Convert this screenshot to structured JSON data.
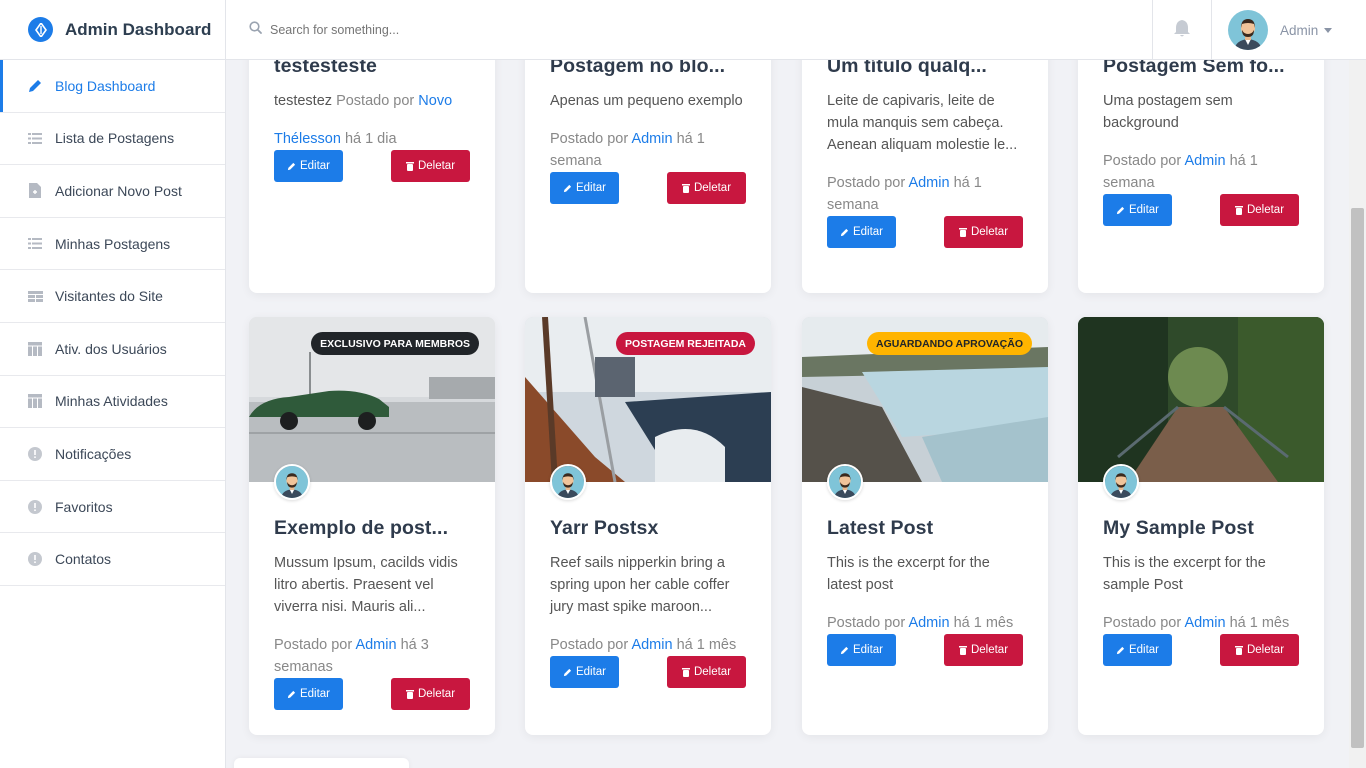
{
  "app": {
    "title": "Admin Dashboard"
  },
  "sidebar": {
    "items": [
      {
        "label": "Blog Dashboard",
        "icon": "pencil-icon",
        "active": true
      },
      {
        "label": "Lista de Postagens",
        "icon": "list-icon"
      },
      {
        "label": "Adicionar Novo Post",
        "icon": "file-add-icon"
      },
      {
        "label": "Minhas Postagens",
        "icon": "list-icon"
      },
      {
        "label": "Visitantes do Site",
        "icon": "table-icon"
      },
      {
        "label": "Ativ. dos Usuários",
        "icon": "calendar-icon"
      },
      {
        "label": "Minhas Atividades",
        "icon": "calendar-icon"
      },
      {
        "label": "Notificações",
        "icon": "alert-circle-icon"
      },
      {
        "label": "Favoritos",
        "icon": "alert-circle-icon"
      },
      {
        "label": "Contatos",
        "icon": "alert-circle-icon"
      }
    ]
  },
  "topbar": {
    "search_placeholder": "Search for something...",
    "user_name": "Admin"
  },
  "buttons": {
    "edit": "Editar",
    "delete": "Deletar"
  },
  "posts_top": [
    {
      "title": "testesteste",
      "excerpt": "testestez",
      "meta_prefix": "Postado por",
      "author": "Novo Thélesson",
      "time": "há 1 dia"
    },
    {
      "title": "Postagem no blo...",
      "excerpt": "Apenas um pequeno exemplo",
      "meta_prefix": "Postado por",
      "author": "Admin",
      "time": "há 1 semana"
    },
    {
      "title": "Um título qualq...",
      "excerpt": "Leite de capivaris, leite de mula manquis sem cabeça. Aenean aliquam molestie le...",
      "meta_prefix": "Postado por",
      "author": "Admin",
      "time": "há 1 semana"
    },
    {
      "title": "Postagem Sem fo...",
      "excerpt": "Uma postagem sem background",
      "meta_prefix": "Postado por",
      "author": "Admin",
      "time": "há 1 semana"
    }
  ],
  "posts_bottom": [
    {
      "title": "Exemplo de post...",
      "excerpt": "Mussum Ipsum, cacilds vidis litro abertis. Praesent vel viverra nisi. Mauris ali...",
      "meta_prefix": "Postado por",
      "author": "Admin",
      "time": "há 3 semanas",
      "badge": "EXCLUSIVO PARA MEMBROS",
      "badge_color": "#212529",
      "badge_text_color": "#ffffff",
      "image": "car-photo"
    },
    {
      "title": "Yarr Postsx",
      "excerpt": "Reef sails nipperkin bring a spring upon her cable coffer jury mast spike maroon...",
      "meta_prefix": "Postado por",
      "author": "Admin",
      "time": "há 1 mês",
      "badge": "POSTAGEM REJEITADA",
      "badge_color": "#c8173f",
      "badge_text_color": "#ffffff",
      "image": "boat-photo"
    },
    {
      "title": "Latest Post",
      "excerpt": "This is the excerpt for the latest post",
      "meta_prefix": "Postado por",
      "author": "Admin",
      "time": "há 1 mês",
      "badge": "AGUARDANDO APROVAÇÃO",
      "badge_color": "#ffb400",
      "badge_text_color": "#212529",
      "image": "waterfall-photo"
    },
    {
      "title": "My Sample Post",
      "excerpt": "This is the excerpt for the sample Post",
      "meta_prefix": "Postado por",
      "author": "Admin",
      "time": "há 1 mês",
      "image": "forest-bridge-photo"
    }
  ],
  "colors": {
    "primary": "#1c7ce8",
    "danger": "#c8173f",
    "warning": "#ffb400",
    "dark": "#212529"
  }
}
